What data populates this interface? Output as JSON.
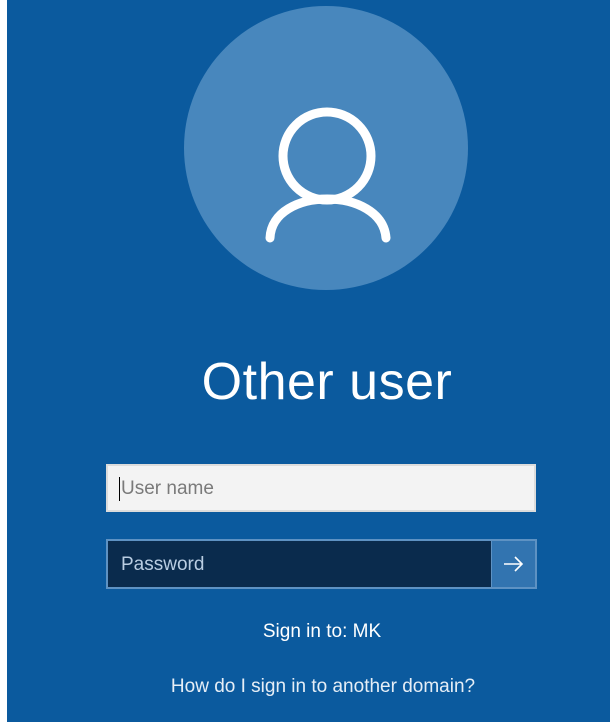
{
  "user": {
    "display_name": "Other user",
    "avatar_icon": "user-silhouette-icon"
  },
  "login": {
    "username_placeholder": "User name",
    "password_placeholder": "Password",
    "submit_icon": "arrow-right-icon"
  },
  "sign_in_to": "Sign in to: MK",
  "domain_help_link": "How do I sign in to another domain?",
  "colors": {
    "background": "#0b5a9e",
    "avatar_circle": "#4887bd",
    "password_field": "#0a2b4d",
    "submit_button": "#3274b0"
  }
}
